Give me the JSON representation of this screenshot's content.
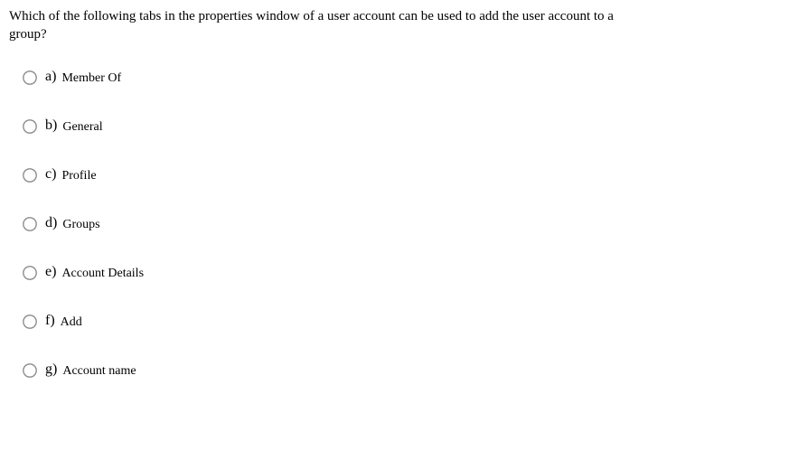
{
  "question": "Which of the following tabs in the properties window of a user account can be used to add the user account to a group?",
  "options": [
    {
      "letter": "a)",
      "text": "Member Of"
    },
    {
      "letter": "b)",
      "text": "General"
    },
    {
      "letter": "c)",
      "text": "Profile"
    },
    {
      "letter": "d)",
      "text": "Groups"
    },
    {
      "letter": "e)",
      "text": "Account Details"
    },
    {
      "letter": "f)",
      "text": "Add"
    },
    {
      "letter": "g)",
      "text": "Account name"
    }
  ]
}
